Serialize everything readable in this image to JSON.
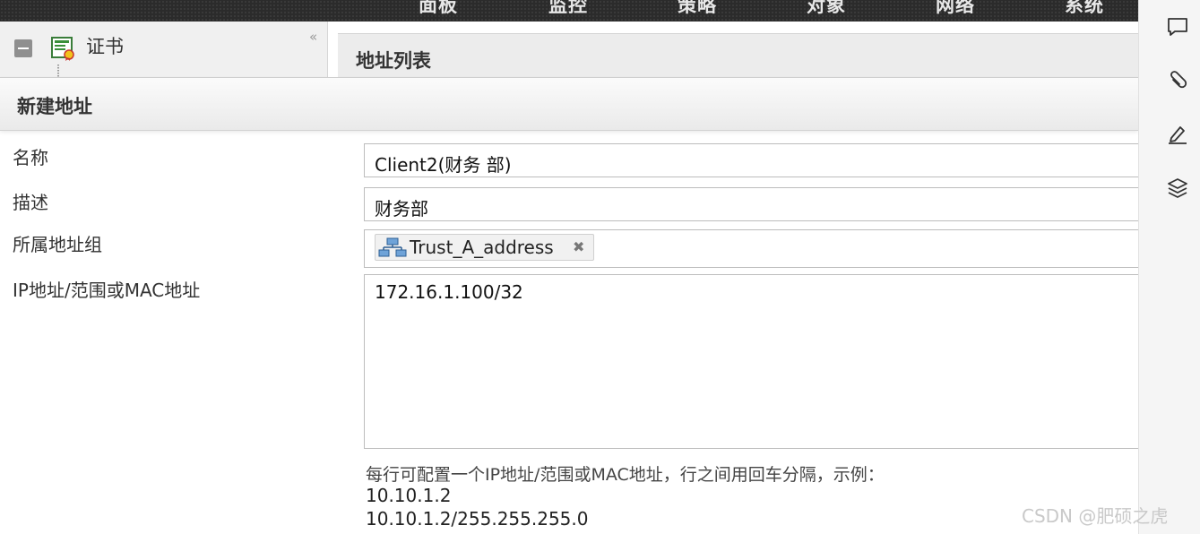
{
  "topnav": {
    "items": [
      "面板",
      "监控",
      "策略",
      "对象",
      "网络",
      "系统"
    ]
  },
  "left_panel": {
    "tree_item_label": "证书",
    "collapse_glyph": "«"
  },
  "address_list": {
    "title": "地址列表"
  },
  "dialog": {
    "title": "新建地址",
    "fields": {
      "name_label": "名称",
      "name_value": "Client2(财务 部)",
      "desc_label": "描述",
      "desc_value": "财务部",
      "group_label": "所属地址组",
      "group_tag": "Trust_A_address",
      "group_tag_remove": "✖",
      "ip_label": "IP地址/范围或MAC地址",
      "ip_value": "172.16.1.100/32"
    },
    "hint": {
      "line1": "每行可配置一个IP地址/范围或MAC地址，行之间用回车分隔，示例：",
      "line2": "10.10.1.2",
      "line3": "10.10.1.2/255.255.255.0"
    }
  },
  "side_toolbar": {
    "icons": [
      "comment-icon",
      "paperclip-icon",
      "pen-icon",
      "layers-icon"
    ]
  },
  "watermark": "CSDN @肥硕之虎",
  "colors": {
    "topnav_bg": "#2b2b2b",
    "header_bg": "#eaeaea",
    "border": "#bdbdbd"
  }
}
